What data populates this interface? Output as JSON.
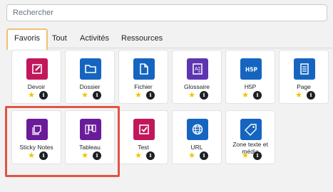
{
  "search": {
    "placeholder": "Rechercher",
    "value": ""
  },
  "tabs": [
    {
      "label": "Favoris",
      "active": true
    },
    {
      "label": "Tout",
      "active": false
    },
    {
      "label": "Activités",
      "active": false
    },
    {
      "label": "Ressources",
      "active": false
    }
  ],
  "cards": [
    {
      "label": "Devoir",
      "icon": "assignment-icon",
      "color": "#c2185b"
    },
    {
      "label": "Dossier",
      "icon": "folder-icon",
      "color": "#1565c0"
    },
    {
      "label": "Fichier",
      "icon": "file-icon",
      "color": "#1565c0"
    },
    {
      "label": "Glossaire",
      "icon": "glossary-icon",
      "color": "#5e35b1"
    },
    {
      "label": "H5P",
      "icon": "h5p-icon",
      "color": "#1565c0"
    },
    {
      "label": "Page",
      "icon": "page-icon",
      "color": "#1565c0"
    },
    {
      "label": "Sticky Notes",
      "icon": "sticky-notes-icon",
      "color": "#6a1b9a"
    },
    {
      "label": "Tableau",
      "icon": "board-icon",
      "color": "#6a1b9a"
    },
    {
      "label": "Test",
      "icon": "quiz-icon",
      "color": "#c2185b"
    },
    {
      "label": "URL",
      "icon": "globe-icon",
      "color": "#1565c0"
    },
    {
      "label": "Zone texte et média",
      "icon": "label-tag-icon",
      "color": "#1565c0"
    }
  ],
  "favorite_star": "★",
  "info_glyph": "i"
}
